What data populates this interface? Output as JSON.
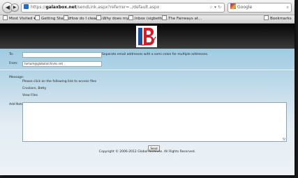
{
  "browser": {
    "url_prefix": "https://",
    "url_domain": "galaxbox.net",
    "url_path": "/sendLink.aspx?referrer=../default.aspx",
    "search_engine": "Google",
    "bookmarks_label": "Bookmarks",
    "bookmarks": [
      "Most Visited",
      "Getting Started",
      "How do I clean u...",
      "Why does my e...",
      "Inbox (sigbetter...",
      "The Fairways at..."
    ]
  },
  "form": {
    "to_label": "To:",
    "to_value": "",
    "to_hint": "Separate email addresses with a semi colon for multiple addresses.",
    "from_label": "From:",
    "from_value": "tomam@globalarchives.net",
    "message_label": "Message:",
    "message_line1": "Please click on the following link to access files",
    "message_line2": "Crockers, Betty",
    "message_line3": "View Files",
    "add_note_label": "Add Note:",
    "send_label": "Send"
  },
  "footer": {
    "copyright": "Copyright © 2006-2012 Global Archives. All Rights Reserved."
  },
  "colors": {
    "logo_blue": "#1b4fa0",
    "logo_red": "#d01d2a"
  }
}
